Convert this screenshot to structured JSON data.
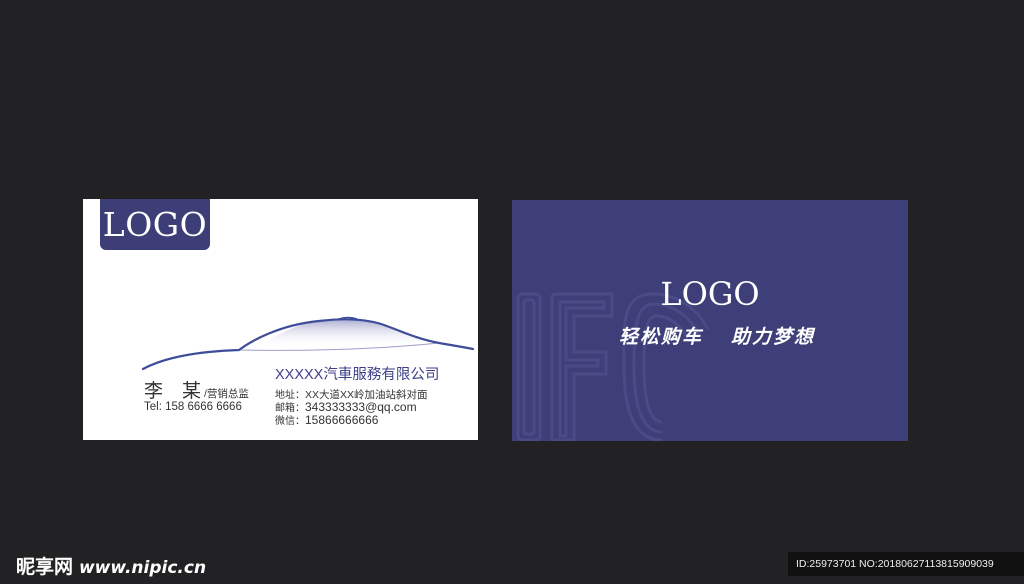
{
  "front_card": {
    "logo": "LOGO",
    "company": "XXXXX汽車服務有限公司",
    "name": "李　某",
    "title": "/营销总监",
    "tel": "Tel: 158 6666 6666",
    "address_label": "地址：",
    "address": "XX大道XX岭加油站斜对面",
    "email_label": "邮箱：",
    "email": "343333333@qq.com",
    "wechat_label": "微信：",
    "wechat": "15866666666"
  },
  "back_card": {
    "logo": "LOGO",
    "slogan_left": "轻松购车",
    "slogan_right": "助力梦想"
  },
  "footer": {
    "site_cn": "昵享网",
    "site_url": "www.nipic.cn",
    "id_text": "ID:25973701 NO:20180627113815909039"
  },
  "colors": {
    "background": "#222224",
    "brand_navy": "#3e3f78",
    "company_text": "#3d3e8a",
    "card_white": "#ffffff"
  },
  "icons": {
    "car_silhouette": "car-outline-icon",
    "watermark_letters": "ifc-watermark-icon"
  }
}
